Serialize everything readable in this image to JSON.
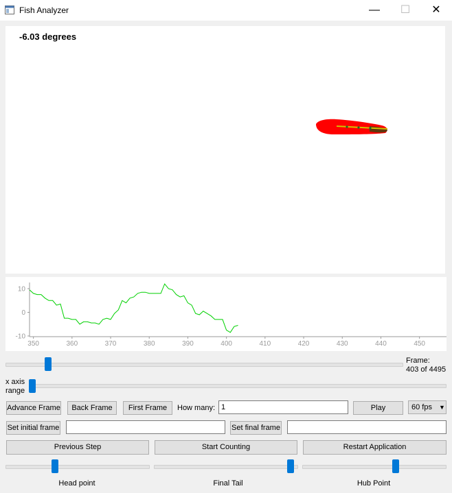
{
  "window": {
    "title": "Fish Analyzer",
    "minimize": "—",
    "maximize": "☐",
    "close": "✕"
  },
  "video": {
    "angle_text": "-6.03 degrees"
  },
  "graph": {
    "y_ticks": [
      "10",
      "0",
      "-10"
    ],
    "x_ticks": [
      "350",
      "360",
      "370",
      "380",
      "390",
      "400",
      "410",
      "420",
      "430",
      "440",
      "450"
    ],
    "x_range": [
      349,
      457
    ],
    "y_range": [
      -10,
      10
    ],
    "line_color": "#00d000",
    "series": {
      "x": [
        349,
        350,
        351,
        352,
        353,
        354,
        355,
        356,
        357,
        358,
        359,
        360,
        361,
        362,
        363,
        364,
        365,
        366,
        367,
        368,
        369,
        370,
        371,
        372,
        373,
        374,
        375,
        376,
        377,
        378,
        379,
        380,
        381,
        382,
        383,
        384,
        385,
        386,
        387,
        388,
        389,
        390,
        391,
        392,
        393,
        394,
        395,
        396,
        397,
        398,
        399,
        400,
        401,
        402,
        403
      ],
      "y": [
        9.5,
        8,
        7.5,
        7.5,
        6,
        5,
        5,
        3,
        3.5,
        -2.5,
        -2.5,
        -3,
        -3,
        -5,
        -4,
        -4,
        -4.5,
        -4.5,
        -5,
        -3,
        -2.5,
        -3,
        -0.5,
        1,
        5,
        4,
        6,
        6.5,
        8,
        8.5,
        8.5,
        8,
        8,
        8,
        8,
        12,
        10,
        9.5,
        7.5,
        6.5,
        7,
        4,
        3,
        -0.5,
        -1,
        0.5,
        -0.5,
        -1.5,
        -3,
        -3,
        -3,
        -7.5,
        -8.5,
        -6,
        -5.5
      ]
    }
  },
  "frame": {
    "label": "Frame:",
    "value": "403 of 4495",
    "progress": 0.1
  },
  "xaxis": {
    "label_line1": "x axis",
    "label_line2": "range",
    "value": 0
  },
  "controls": {
    "advance_frame": "Advance Frame",
    "back_frame": "Back Frame",
    "first_frame": "First Frame",
    "how_many_label": "How many:",
    "how_many_value": "1",
    "play": "Play",
    "fps_value": "60 fps",
    "set_initial_frame": "Set initial frame",
    "initial_frame_value": "",
    "set_final_frame": "Set final frame",
    "final_frame_value": ""
  },
  "actions": {
    "previous_step": "Previous Step",
    "start_counting": "Start Counting",
    "restart_application": "Restart Application"
  },
  "point_sliders": {
    "head_point": {
      "label": "Head point",
      "value": 0.34
    },
    "final_tail": {
      "label": "Final Tail",
      "value": 0.98
    },
    "hub_point": {
      "label": "Hub Point",
      "value": 0.66
    }
  }
}
